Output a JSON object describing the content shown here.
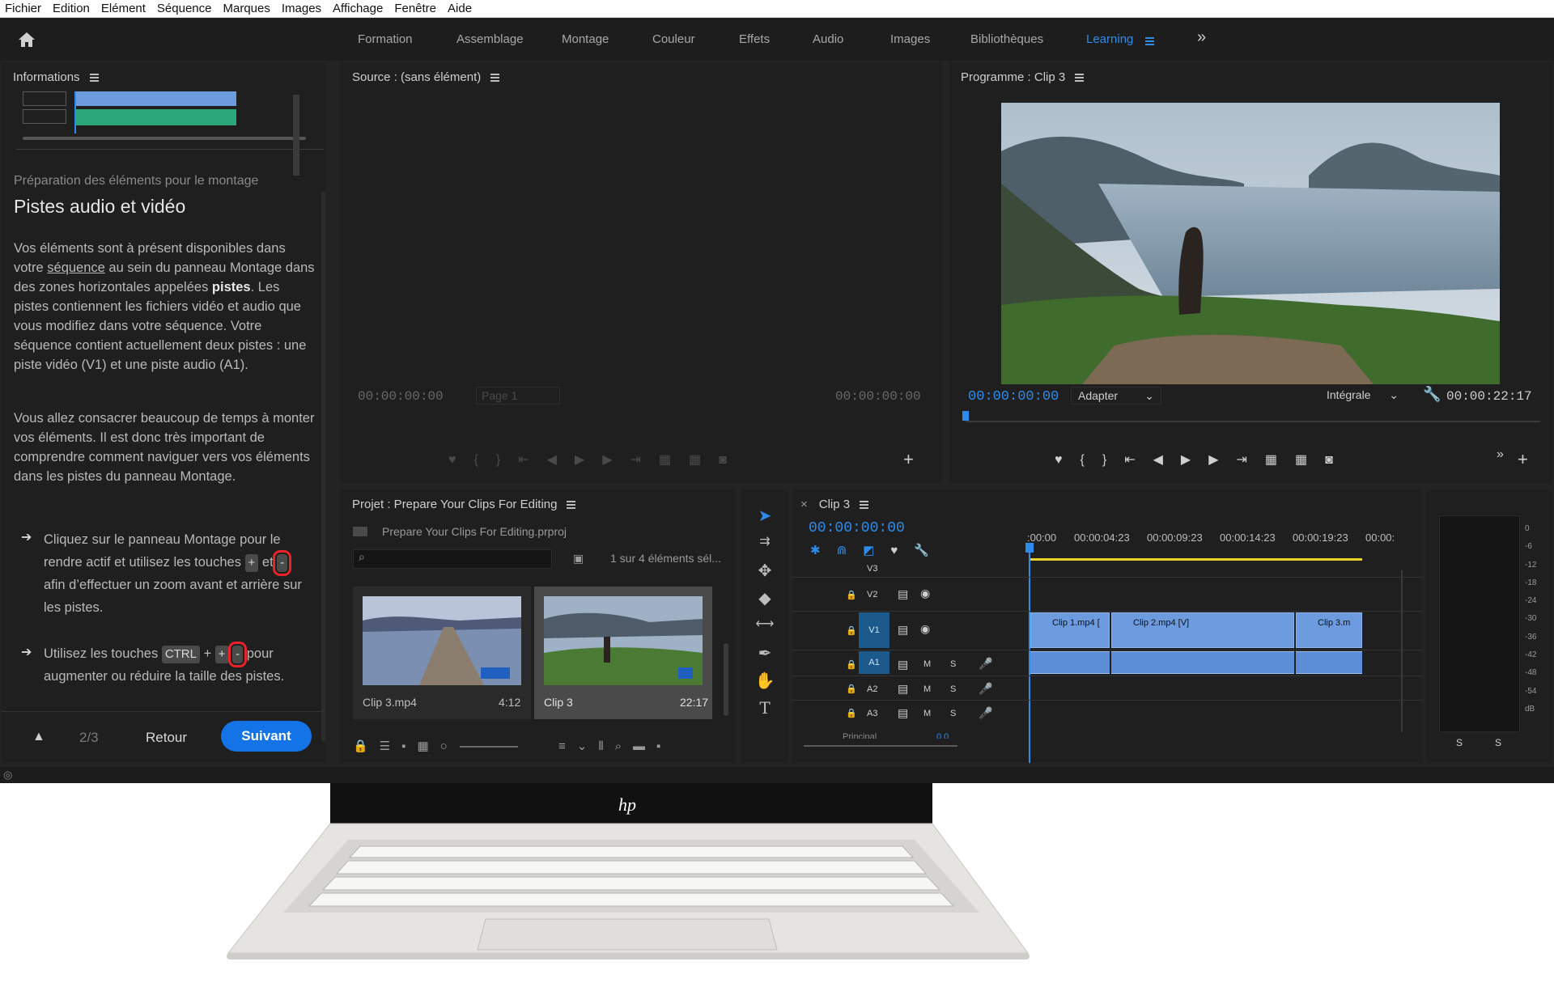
{
  "menu": [
    "Fichier",
    "Edition",
    "Elément",
    "Séquence",
    "Marques",
    "Images",
    "Affichage",
    "Fenêtre",
    "Aide"
  ],
  "workspaces": [
    "Formation",
    "Assemblage",
    "Montage",
    "Couleur",
    "Effets",
    "Audio",
    "Images",
    "Bibliothèques",
    "Learning"
  ],
  "workspace_more": "»",
  "info": {
    "title": "Informations",
    "section": "Préparation des éléments pour le montage",
    "heading": "Pistes audio et vidéo",
    "p1_a": "Vos éléments sont à présent disponibles dans votre ",
    "p1_link": "séquence",
    "p1_b": " au sein du panneau Montage dans des zones horizontales appelées ",
    "p1_bold": "pistes",
    "p1_c": ". Les pistes contiennent les fichiers vidéo et audio que vous modifiez dans votre séquence. Votre séquence contient actuellement deux pistes : une piste vidéo (V1) et une piste audio (A1).",
    "p2": "Vous allez consacrer beaucoup de temps à monter vos éléments. Il est donc très important de comprendre comment naviguer vers vos éléments dans les pistes du panneau Montage.",
    "b1_a": "Cliquez sur le panneau Montage pour le rendre actif et utilisez les touches ",
    "b1_k1": "+",
    "b1_mid": " et ",
    "b1_k2": "-",
    "b1_b": " afin d’effectuer un zoom avant et arrière sur les pistes.",
    "b2_a": "Utilisez les touches ",
    "b2_k1": "CTRL",
    "b2_plus": " + ",
    "b2_k2": "+",
    "b2_k3": "-",
    "b2_b": " pour augmenter ou réduire la taille des pistes.",
    "pager": "2/3",
    "back": "Retour",
    "next": "Suivant",
    "up_icon": "up-arrow-icon"
  },
  "source": {
    "title": "Source : (sans élément)",
    "tc_left": "00:00:00:00",
    "tc_right": "00:00:00:00",
    "page": "Page 1"
  },
  "program": {
    "title": "Programme : Clip 3",
    "tc_left": "00:00:00:00",
    "fit": "Adapter",
    "quality": "Intégrale",
    "tc_right": "00:00:22:17"
  },
  "project": {
    "title": "Projet : Prepare Your Clips For Editing",
    "file": "Prepare Your Clips For Editing.prproj",
    "count": "1 sur 4 éléments sél...",
    "items": [
      {
        "name": "Clip 3.mp4",
        "dur": "4:12"
      },
      {
        "name": "Clip 3",
        "dur": "22:17"
      }
    ]
  },
  "timeline": {
    "title": "Clip 3",
    "tc": "00:00:00:00",
    "ruler": [
      ":00:00",
      "00:00:04:23",
      "00:00:09:23",
      "00:00:14:23",
      "00:00:19:23",
      "00:00:"
    ],
    "tracks": [
      "V3",
      "V2",
      "V1",
      "A1",
      "A2",
      "A3"
    ],
    "clips": [
      "Clip 1.mp4 [",
      "Clip 2.mp4 [V]",
      "Clip 3.m"
    ],
    "m": "M",
    "s": "S",
    "principal": "Principal",
    "principal_val": "0.0"
  },
  "meter": {
    "scale": [
      "0",
      "-6",
      "-12",
      "-18",
      "-24",
      "-30",
      "-36",
      "-42",
      "-48",
      "-54",
      "dB"
    ],
    "solo": [
      "S",
      "S"
    ]
  },
  "colors": {
    "accent": "#2d8ceb",
    "clip": "#6c9be0",
    "v1": "#1d5a8c"
  }
}
